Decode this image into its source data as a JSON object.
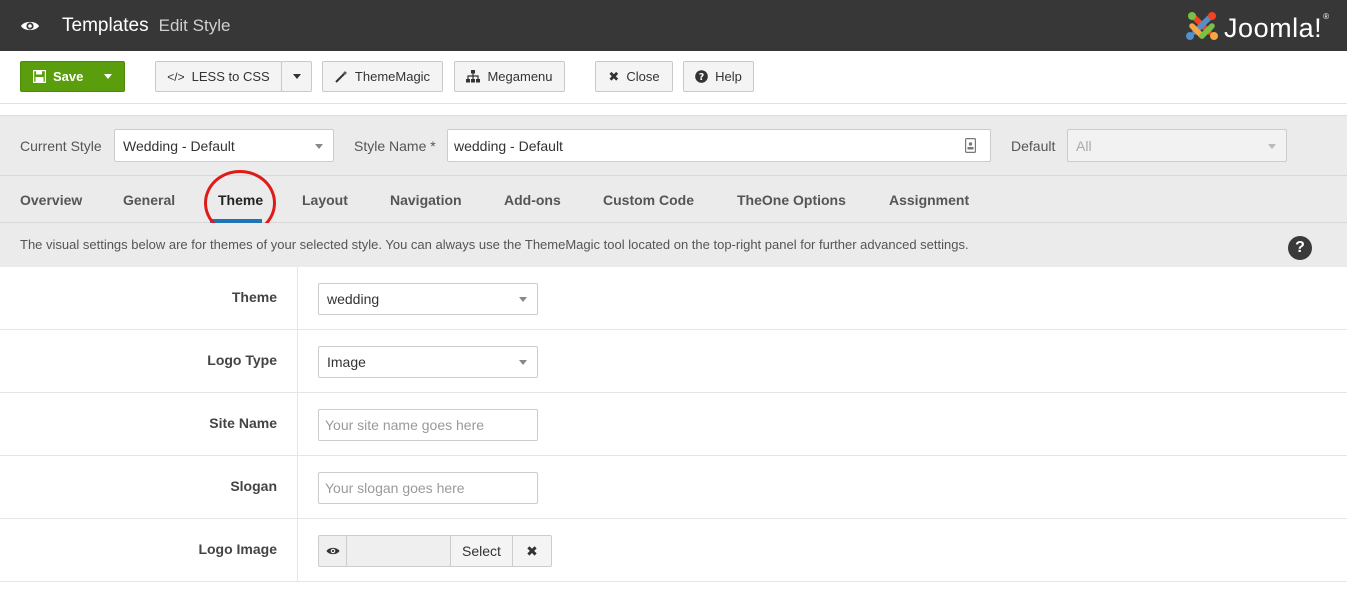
{
  "header": {
    "title": "Templates",
    "subtitle": "Edit Style",
    "brand": "Joomla!",
    "brand_mark": "®",
    "colors": {
      "bar": "#373737"
    }
  },
  "toolbar": {
    "save": "Save",
    "less_to_css": "LESS to CSS",
    "theme_magic": "ThemeMagic",
    "megamenu": "Megamenu",
    "close": "Close",
    "help": "Help",
    "colors": {
      "save": "#5a9e0e"
    }
  },
  "style_bar": {
    "current_style_label": "Current Style",
    "current_style_value": "Wedding - Default",
    "style_name_label": "Style Name *",
    "style_name_value": "wedding - Default",
    "default_label": "Default",
    "default_value": "All"
  },
  "tabs": [
    {
      "label": "Overview"
    },
    {
      "label": "General"
    },
    {
      "label": "Theme",
      "active": true
    },
    {
      "label": "Layout"
    },
    {
      "label": "Navigation"
    },
    {
      "label": "Add-ons"
    },
    {
      "label": "Custom Code"
    },
    {
      "label": "TheOne Options"
    },
    {
      "label": "Assignment"
    }
  ],
  "info": {
    "text": "The visual settings below are for themes of your selected style. You can always use the ThemeMagic tool located on the top-right panel for further advanced settings.",
    "help_glyph": "?"
  },
  "form": {
    "theme_label": "Theme",
    "theme_value": "wedding",
    "logo_type_label": "Logo Type",
    "logo_type_value": "Image",
    "site_name_label": "Site Name",
    "site_name_placeholder": "Your site name goes here",
    "slogan_label": "Slogan",
    "slogan_placeholder": "Your slogan goes here",
    "logo_image_label": "Logo Image",
    "logo_image_select": "Select",
    "logo_image_clear": "✖"
  }
}
